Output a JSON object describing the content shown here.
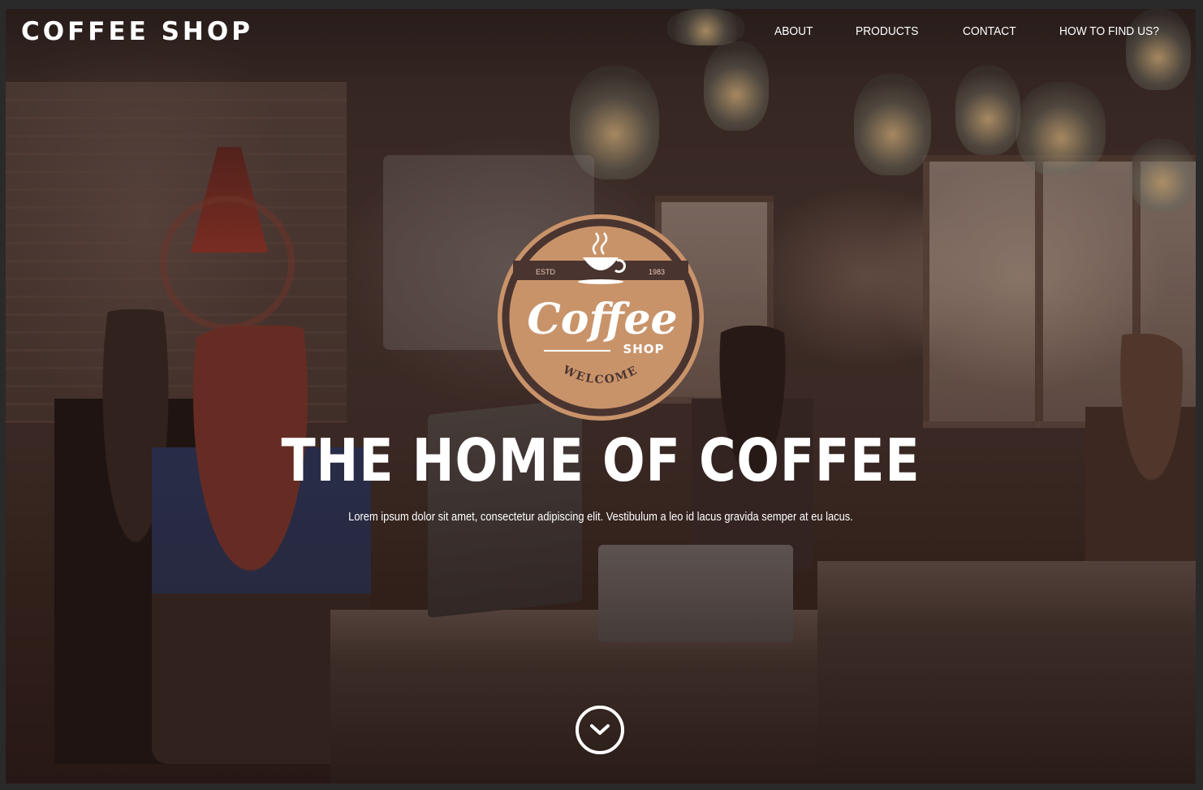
{
  "header": {
    "brand": "COFFEE SHOP",
    "nav": [
      "ABOUT",
      "PRODUCTS",
      "CONTACT",
      "HOW TO FIND US?"
    ]
  },
  "badge": {
    "estd": "ESTD",
    "year": "1983",
    "word": "Coffee",
    "word2": "SHOP",
    "welcome": "WELCOME",
    "colors": {
      "outer": "#c9936a",
      "ring": "#4a3430",
      "inner": "#c9936a"
    }
  },
  "hero": {
    "title": "THE HOME OF COFFEE",
    "subtitle": "Lorem ipsum dolor sit amet, consectetur adipiscing elit. Vestibulum a leo id lacus gravida semper at eu lacus."
  },
  "scroll": {
    "icon": "chevron-down-circle-icon"
  }
}
